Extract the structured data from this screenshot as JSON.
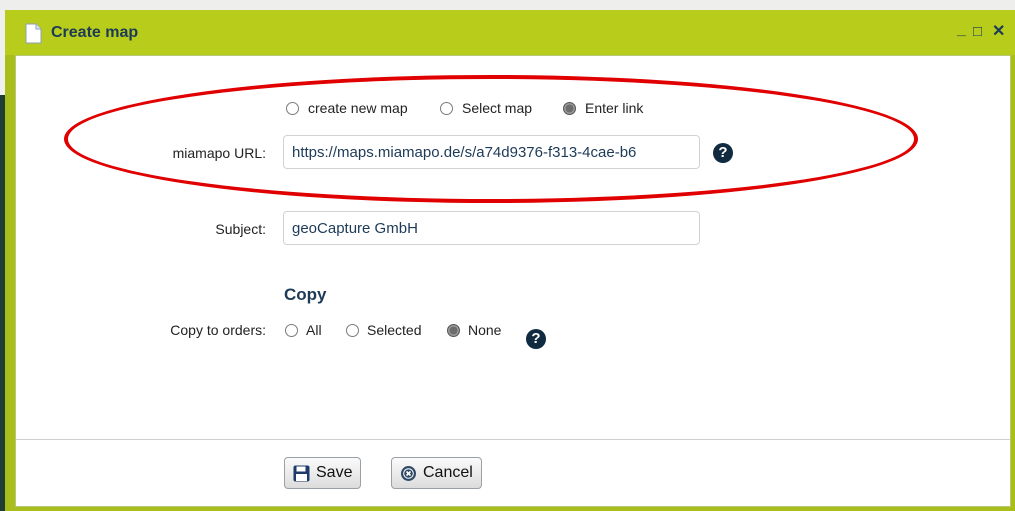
{
  "window": {
    "title": "Create map",
    "minimize_glyph": "_",
    "maximize_glyph": "□",
    "close_glyph": "✕"
  },
  "map_source": {
    "options": [
      {
        "label": "create new map",
        "selected": false
      },
      {
        "label": "Select map",
        "selected": false
      },
      {
        "label": "Enter link",
        "selected": true
      }
    ]
  },
  "url_field": {
    "label": "miamapo URL:",
    "value": "https://maps.miamapo.de/s/a74d9376-f313-4cae-b6"
  },
  "subject_field": {
    "label": "Subject:",
    "value": "geoCapture GmbH"
  },
  "copy_section": {
    "heading": "Copy",
    "label": "Copy to orders:",
    "options": [
      {
        "label": "All",
        "selected": false
      },
      {
        "label": "Selected",
        "selected": false
      },
      {
        "label": "None",
        "selected": true
      }
    ]
  },
  "help_glyph": "?",
  "buttons": {
    "save": "Save",
    "cancel": "Cancel"
  },
  "colors": {
    "titlebar": "#b8cc1c",
    "title_text": "#1d3a57",
    "highlight_oval": "#e00000"
  }
}
